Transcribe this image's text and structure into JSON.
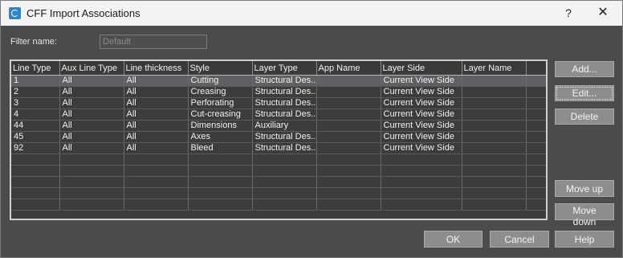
{
  "window": {
    "title": "CFF Import Associations",
    "help_glyph": "?",
    "close_glyph": "✕"
  },
  "filter": {
    "label": "Filter name:",
    "value": "Default"
  },
  "grid": {
    "columns": [
      "Line Type",
      "Aux Line Type",
      "Line thickness",
      "Style",
      "Layer Type",
      "App Name",
      "Layer Side",
      "Layer Name",
      ""
    ],
    "rows": [
      [
        "1",
        "All",
        "All",
        "Cutting",
        "Structural Des...",
        "",
        "Current View Side",
        "",
        ""
      ],
      [
        "2",
        "All",
        "All",
        "Creasing",
        "Structural Des...",
        "",
        "Current View Side",
        "",
        ""
      ],
      [
        "3",
        "All",
        "All",
        "Perforating",
        "Structural Des...",
        "",
        "Current View Side",
        "",
        ""
      ],
      [
        "4",
        "All",
        "All",
        "Cut-creasing",
        "Structural Des...",
        "",
        "Current View Side",
        "",
        ""
      ],
      [
        "44",
        "All",
        "All",
        "Dimensions",
        "Auxiliary",
        "",
        "Current View Side",
        "",
        ""
      ],
      [
        "45",
        "All",
        "All",
        "Axes",
        "Structural Des...",
        "",
        "Current View Side",
        "",
        ""
      ],
      [
        "92",
        "All",
        "All",
        "Bleed",
        "Structural Des...",
        "",
        "Current View Side",
        "",
        ""
      ],
      [
        "",
        "",
        "",
        "",
        "",
        "",
        "",
        "",
        ""
      ],
      [
        "",
        "",
        "",
        "",
        "",
        "",
        "",
        "",
        ""
      ],
      [
        "",
        "",
        "",
        "",
        "",
        "",
        "",
        "",
        ""
      ],
      [
        "",
        "",
        "",
        "",
        "",
        "",
        "",
        "",
        ""
      ],
      [
        "",
        "",
        "",
        "",
        "",
        "",
        "",
        "",
        ""
      ]
    ],
    "selected_row": 0
  },
  "buttons": {
    "add": "Add...",
    "edit": "Edit...",
    "delete": "Delete",
    "move_up": "Move up",
    "move_down": "Move down",
    "ok": "OK",
    "cancel": "Cancel",
    "help": "Help"
  }
}
